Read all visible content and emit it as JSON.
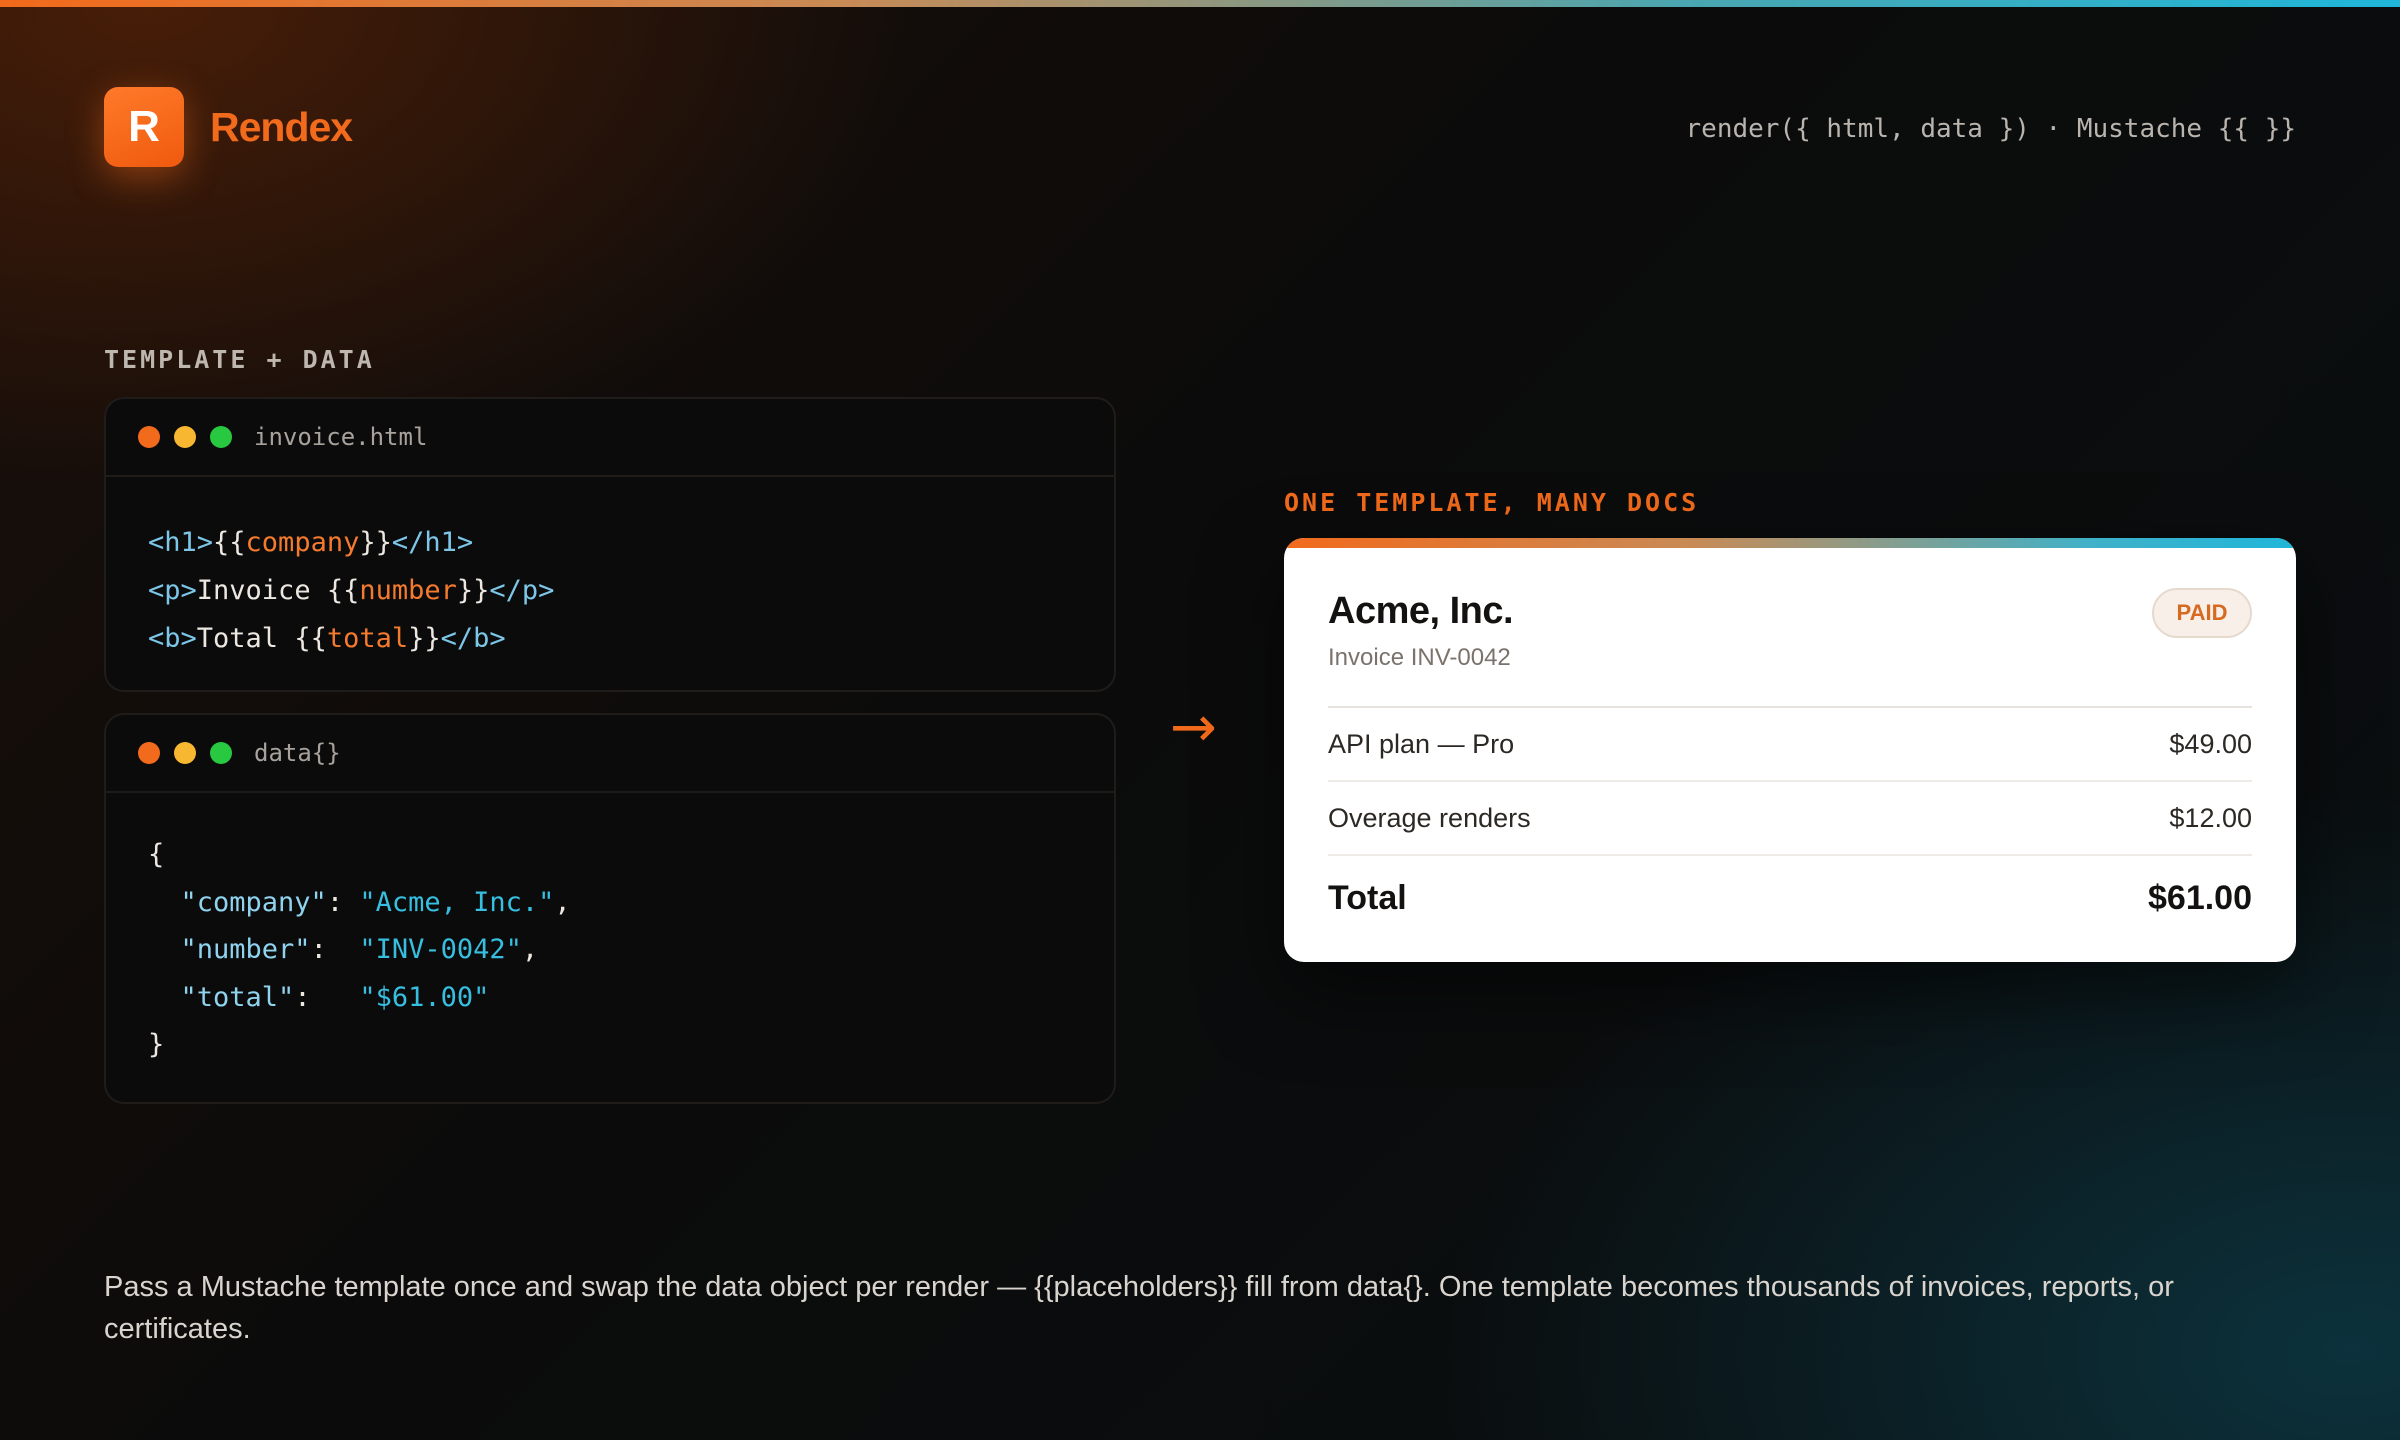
{
  "brand": {
    "logo_letter": "R",
    "name": "Rendex",
    "tagline": "render({ html, data }) · Mustache {{ }}"
  },
  "colors": {
    "accent": "#f26a1b",
    "teal": "#1fb6d9",
    "background": "#0b0b0b"
  },
  "left_section": {
    "label": "TEMPLATE + DATA",
    "template_card": {
      "filename": "invoice.html",
      "lines": [
        {
          "open": "<h1>",
          "pre": "{{",
          "var": "company",
          "post": "}}",
          "close": "</h1>"
        },
        {
          "open": "<p>",
          "pre": "Invoice {{",
          "var": "number",
          "post": "}}",
          "close": "</p>"
        },
        {
          "open": "<b>",
          "pre": "Total {{",
          "var": "total",
          "post": "}}",
          "close": "</b>"
        }
      ]
    },
    "data_card": {
      "filename": "data{}",
      "open_brace": "{",
      "close_brace": "}",
      "entries": [
        {
          "key": "\"company\"",
          "sep": ": ",
          "value": "\"Acme, Inc.\"",
          "trail": ","
        },
        {
          "key": "\"number\"",
          "sep": ":  ",
          "value": "\"INV-0042\"",
          "trail": ","
        },
        {
          "key": "\"total\"",
          "sep": ":   ",
          "value": "\"$61.00\"",
          "trail": ""
        }
      ]
    }
  },
  "arrow": "→",
  "right_section": {
    "label": "ONE TEMPLATE, MANY DOCS",
    "document": {
      "company": "Acme, Inc.",
      "subtitle": "Invoice INV-0042",
      "status": "PAID",
      "line_items": [
        {
          "label": "API plan — Pro",
          "amount": "$49.00"
        },
        {
          "label": "Overage renders",
          "amount": "$12.00"
        }
      ],
      "total_label": "Total",
      "total_amount": "$61.00"
    }
  },
  "caption": "Pass a Mustache template once and swap the data object per render — {{placeholders}} fill from data{}. One template becomes thousands of invoices, reports, or certificates."
}
